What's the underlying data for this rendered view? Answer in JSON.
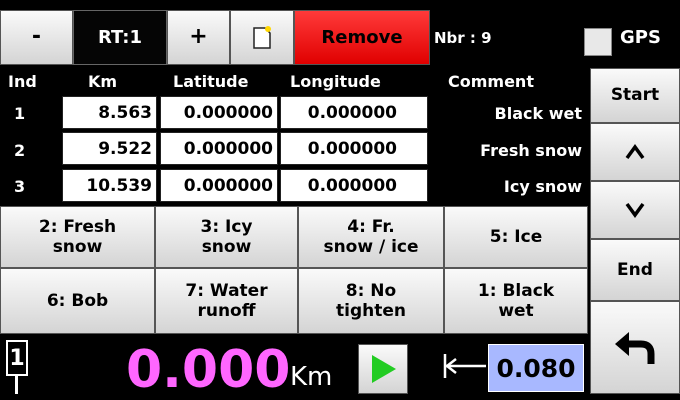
{
  "toolbar": {
    "minus_label": "-",
    "route_label": "RT:1",
    "plus_label": "+",
    "new_icon": "new-document-icon",
    "remove_label": "Remove",
    "count_label": "Nbr : 9",
    "gps_label": "GPS",
    "gps_checked": false
  },
  "table": {
    "headers": {
      "ind": "Ind",
      "km": "Km",
      "latitude": "Latitude",
      "longitude": "Longitude",
      "comment": "Comment"
    },
    "rows": [
      {
        "ind": "1",
        "km": "8.563",
        "latitude": "0.000000",
        "longitude": "0.000000",
        "comment": "Black wet"
      },
      {
        "ind": "2",
        "km": "9.522",
        "latitude": "0.000000",
        "longitude": "0.000000",
        "comment": "Fresh snow"
      },
      {
        "ind": "3",
        "km": "10.539",
        "latitude": "0.000000",
        "longitude": "0.000000",
        "comment": "Icy snow"
      }
    ]
  },
  "categories": [
    "2: Fresh\nsnow",
    "3: Icy\nsnow",
    "4: Fr.\nsnow / ice",
    "5: Ice",
    "6: Bob",
    "7: Water\nrunoff",
    "8: No\ntighten",
    "1: Black\nwet"
  ],
  "side": {
    "start_label": "Start",
    "up_label": "^",
    "down_label": "v",
    "end_label": "End",
    "back_icon": "undo-arrow-icon"
  },
  "status": {
    "lane_number": "1",
    "distance_value": "0.000",
    "distance_unit": "Km",
    "play_icon": "play-icon",
    "offset_icon": "offset-arrow-icon",
    "offset_value": "0.080"
  },
  "colors": {
    "remove": "#f01010",
    "distance": "#ff66ff",
    "play": "#22cc22",
    "offset_bg": "#a8b8ff"
  }
}
